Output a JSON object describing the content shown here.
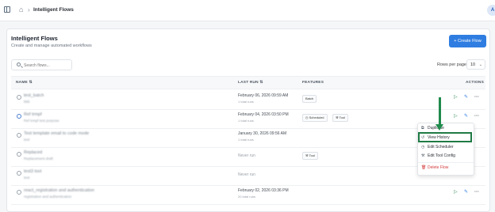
{
  "topbar": {
    "breadcrumb": "Intelligent Flows",
    "avatar": "A"
  },
  "header": {
    "title": "Intelligent Flows",
    "subtitle": "Create and manage automated workflows",
    "create_label": "+ Create Flow"
  },
  "toolbar": {
    "search_placeholder": "Search flows...",
    "rows_label": "Rows per page",
    "rows_value": "10"
  },
  "table": {
    "columns": {
      "name": "NAME ⇅",
      "last_run": "LAST RUN ⇅",
      "features": "FEATURES",
      "actions": "ACTIONS"
    },
    "rows": [
      {
        "name": "test_batch",
        "desc": "bbb",
        "last_run": "February 06, 2026 09:59 AM",
        "runs": "1 total runs",
        "badges": [
          "Batch"
        ]
      },
      {
        "name": "Ref trmpf",
        "desc": "Ref trmpf test purpose",
        "last_run": "February 04, 2026 03:50 PM",
        "runs": "1 total runs",
        "badges": [
          "Scheduled",
          "Tool"
        ]
      },
      {
        "name": "Test template email to code mode",
        "desc": "test",
        "last_run": "January 30, 2026 09:56 AM",
        "runs": "1 total runs",
        "badges": []
      },
      {
        "name": "Replaced",
        "desc": "Replacement draft",
        "last_run": "",
        "never": "Never run",
        "badges": [
          "Tool"
        ]
      },
      {
        "name": "test3 tool",
        "desc": "test",
        "last_run": "",
        "never": "Never run",
        "badges": []
      },
      {
        "name": "react_registration and authentication",
        "desc": "registration and authentication",
        "last_run": "February 02, 2026 03:36 PM",
        "runs": "20 total runs",
        "badges": []
      }
    ]
  },
  "menu": {
    "items": [
      "Duplicate",
      "View History",
      "Edit Scheduler",
      "Edit Tool Config",
      "Delete Flow"
    ]
  },
  "colors": {
    "primary": "#2f7de1",
    "highlight": "#1f7a44",
    "danger": "#d33b3b"
  }
}
